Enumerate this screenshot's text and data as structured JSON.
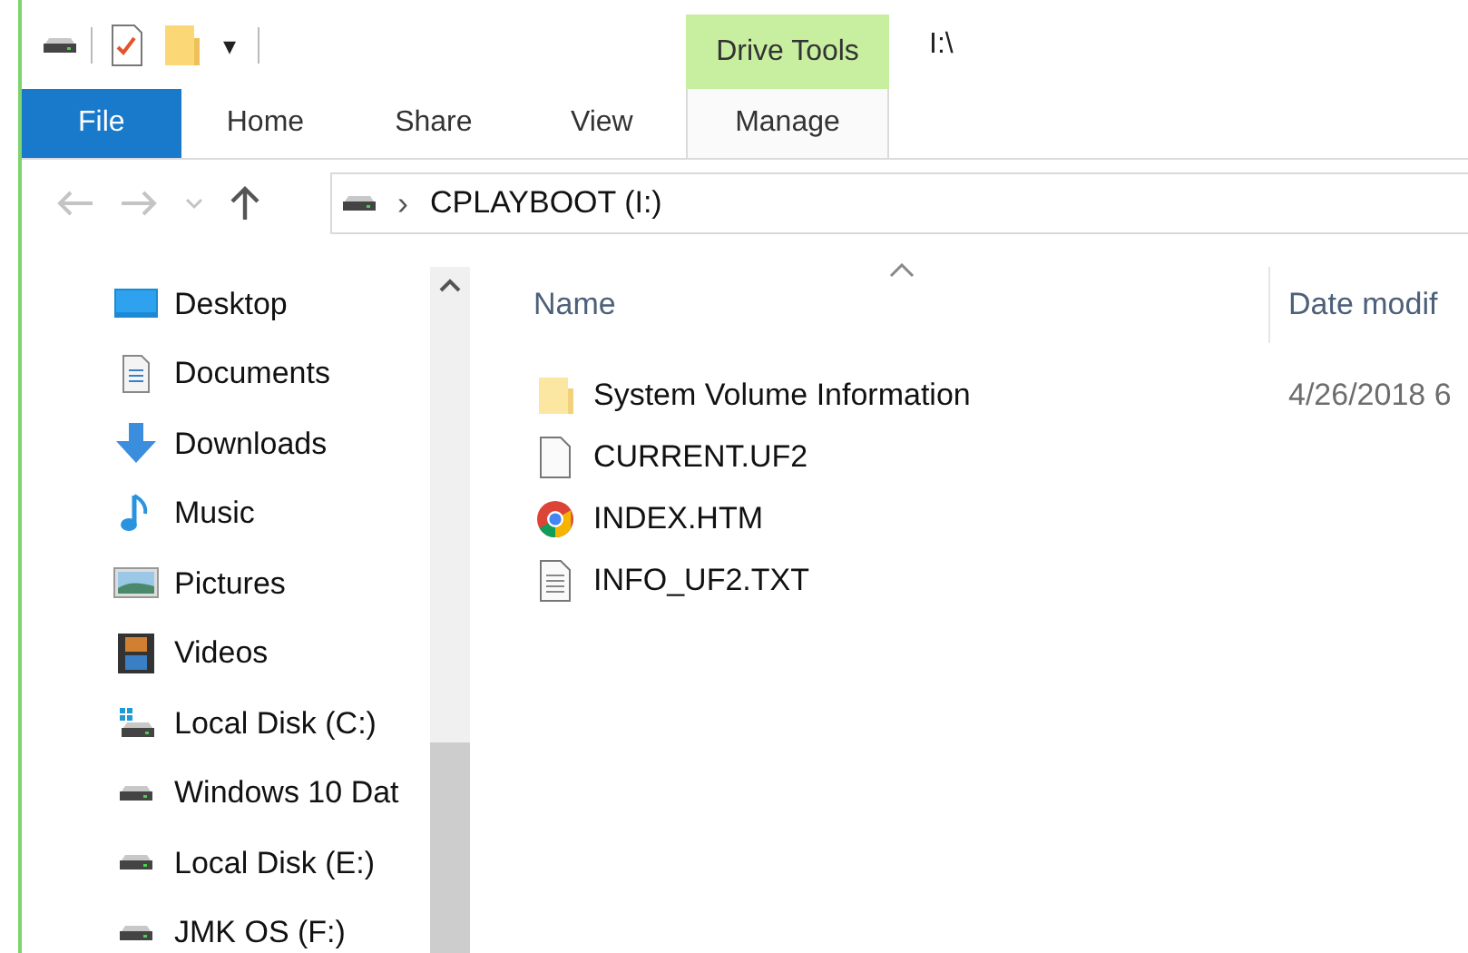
{
  "quick_access_toolbar": {
    "customize_glyph": "▾"
  },
  "contextual_tab_group": {
    "label": "Drive Tools"
  },
  "window": {
    "title": "I:\\"
  },
  "ribbon_tabs": [
    {
      "label": "File",
      "kind": "file"
    },
    {
      "label": "Home",
      "kind": "tab"
    },
    {
      "label": "Share",
      "kind": "tab"
    },
    {
      "label": "View",
      "kind": "tab"
    },
    {
      "label": "Manage",
      "kind": "contextual"
    }
  ],
  "address_bar": {
    "location": "CPLAYBOOT (I:)",
    "separator": "›"
  },
  "navigation_pane": {
    "items": [
      {
        "label": "Desktop",
        "kind": "desktop"
      },
      {
        "label": "Documents",
        "kind": "documents"
      },
      {
        "label": "Downloads",
        "kind": "downloads"
      },
      {
        "label": "Music",
        "kind": "music"
      },
      {
        "label": "Pictures",
        "kind": "pictures"
      },
      {
        "label": "Videos",
        "kind": "videos"
      },
      {
        "label": "Local Disk (C:)",
        "kind": "system-drive"
      },
      {
        "label": "Windows 10 Dat",
        "kind": "drive"
      },
      {
        "label": "Local Disk (E:)",
        "kind": "drive"
      },
      {
        "label": "JMK OS (F:)",
        "kind": "drive"
      }
    ]
  },
  "file_list": {
    "columns": [
      {
        "label": "Name",
        "sorted": true
      },
      {
        "label": "Date modif",
        "sorted": false
      }
    ],
    "rows": [
      {
        "name": "System Volume Information",
        "kind": "folder",
        "date": "4/26/2018 6"
      },
      {
        "name": "CURRENT.UF2",
        "kind": "file"
      },
      {
        "name": "INDEX.HTM",
        "kind": "web"
      },
      {
        "name": "INFO_UF2.TXT",
        "kind": "text"
      }
    ]
  }
}
